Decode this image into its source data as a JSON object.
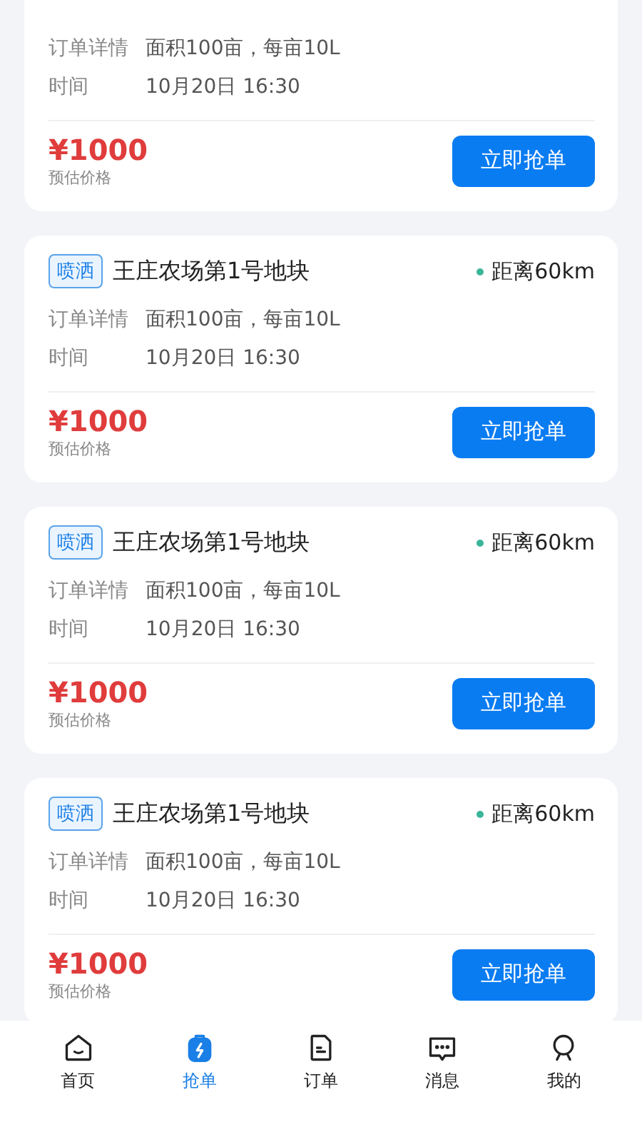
{
  "orders": [
    {
      "detail_label": "订单详情",
      "detail": "面积100亩，每亩10L",
      "time_label": "时间",
      "time": "10月20日 16:30",
      "price": "¥1000",
      "price_label": "预估价格",
      "button": "立即抢单"
    },
    {
      "tag": "喷洒",
      "title": "王庄农场第1号地块",
      "distance": "距离60km",
      "detail_label": "订单详情",
      "detail": "面积100亩，每亩10L",
      "time_label": "时间",
      "time": "10月20日 16:30",
      "price": "¥1000",
      "price_label": "预估价格",
      "button": "立即抢单"
    },
    {
      "tag": "喷洒",
      "title": "王庄农场第1号地块",
      "distance": "距离60km",
      "detail_label": "订单详情",
      "detail": "面积100亩，每亩10L",
      "time_label": "时间",
      "time": "10月20日 16:30",
      "price": "¥1000",
      "price_label": "预估价格",
      "button": "立即抢单"
    },
    {
      "tag": "喷洒",
      "title": "王庄农场第1号地块",
      "distance": "距离60km",
      "detail_label": "订单详情",
      "detail": "面积100亩，每亩10L",
      "time_label": "时间",
      "time": "10月20日 16:30",
      "price": "¥1000",
      "price_label": "预估价格",
      "button": "立即抢单"
    }
  ],
  "tabbar": [
    {
      "kind": "home",
      "label": "首页",
      "selected": false
    },
    {
      "kind": "grab",
      "label": "抢单",
      "selected": true
    },
    {
      "kind": "orders",
      "label": "订单",
      "selected": false
    },
    {
      "kind": "messages",
      "label": "消息",
      "selected": false
    },
    {
      "kind": "profile",
      "label": "我的",
      "selected": false
    }
  ]
}
